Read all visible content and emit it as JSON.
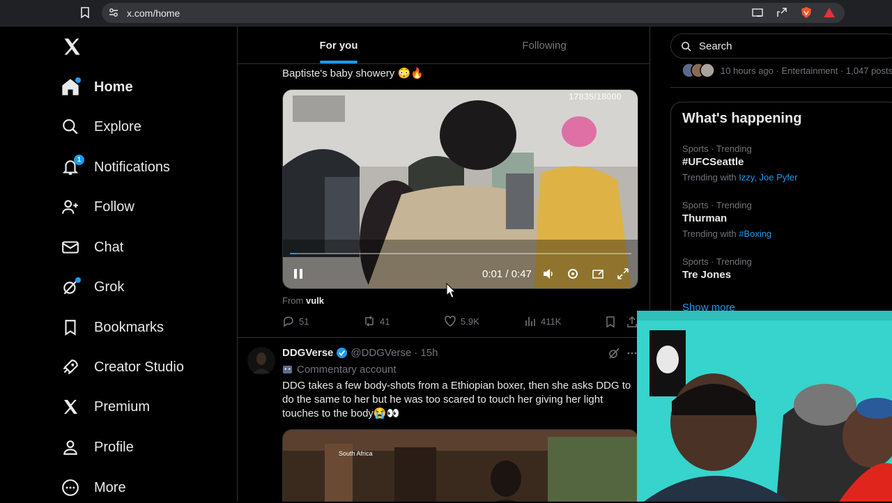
{
  "browser": {
    "url": "x.com/home"
  },
  "nav": {
    "items": [
      {
        "label": "Home",
        "icon": "home-icon"
      },
      {
        "label": "Explore",
        "icon": "search-icon"
      },
      {
        "label": "Notifications",
        "icon": "bell-icon",
        "badge": "1"
      },
      {
        "label": "Follow",
        "icon": "follow-icon"
      },
      {
        "label": "Chat",
        "icon": "mail-icon"
      },
      {
        "label": "Grok",
        "icon": "grok-icon"
      },
      {
        "label": "Bookmarks",
        "icon": "bookmark-icon"
      },
      {
        "label": "Creator Studio",
        "icon": "rocket-icon"
      },
      {
        "label": "Premium",
        "icon": "x-logo-icon"
      },
      {
        "label": "Profile",
        "icon": "person-icon"
      },
      {
        "label": "More",
        "icon": "more-circle-icon"
      }
    ]
  },
  "tabs": {
    "for_you": "For you",
    "following": "Following"
  },
  "tweet1": {
    "text_tail": "Baptiste's baby showery 😳🔥",
    "video": {
      "counter": "17835/18000",
      "time": "0:01 / 0:47",
      "progress": 0.02
    },
    "from_label": "From",
    "from_user": "vulk",
    "replies": "51",
    "reposts": "41",
    "likes": "5.9K",
    "views": "411K"
  },
  "tweet2": {
    "name": "DDGVerse",
    "handle": "@DDGVerse",
    "time": "· 15h",
    "account_label": "Commentary account",
    "text": "DDG takes a few body-shots from a Ethiopian boxer, then she asks DDG to do the same to her but he was too scared to touch her giving her light touches to the body😭👀",
    "media_caption": "South Africa"
  },
  "right": {
    "search_placeholder": "Search",
    "trend_top_meta": "10 hours ago · Entertainment · 1,047 posts",
    "whats_happening": "What's happening",
    "trends": [
      {
        "meta": "Sports · Trending",
        "name": "#UFCSeattle",
        "with_label": "Trending with",
        "with": "Izzy, Joe Pyfer"
      },
      {
        "meta": "Sports · Trending",
        "name": "Thurman",
        "with_label": "Trending with",
        "with": "#Boxing"
      },
      {
        "meta": "Sports · Trending",
        "name": "Tre Jones"
      }
    ],
    "show_more": "Show more"
  },
  "colors": {
    "accent": "#1d9bf0",
    "background": "#000000",
    "muted": "#71767b",
    "border": "#2f3336"
  }
}
